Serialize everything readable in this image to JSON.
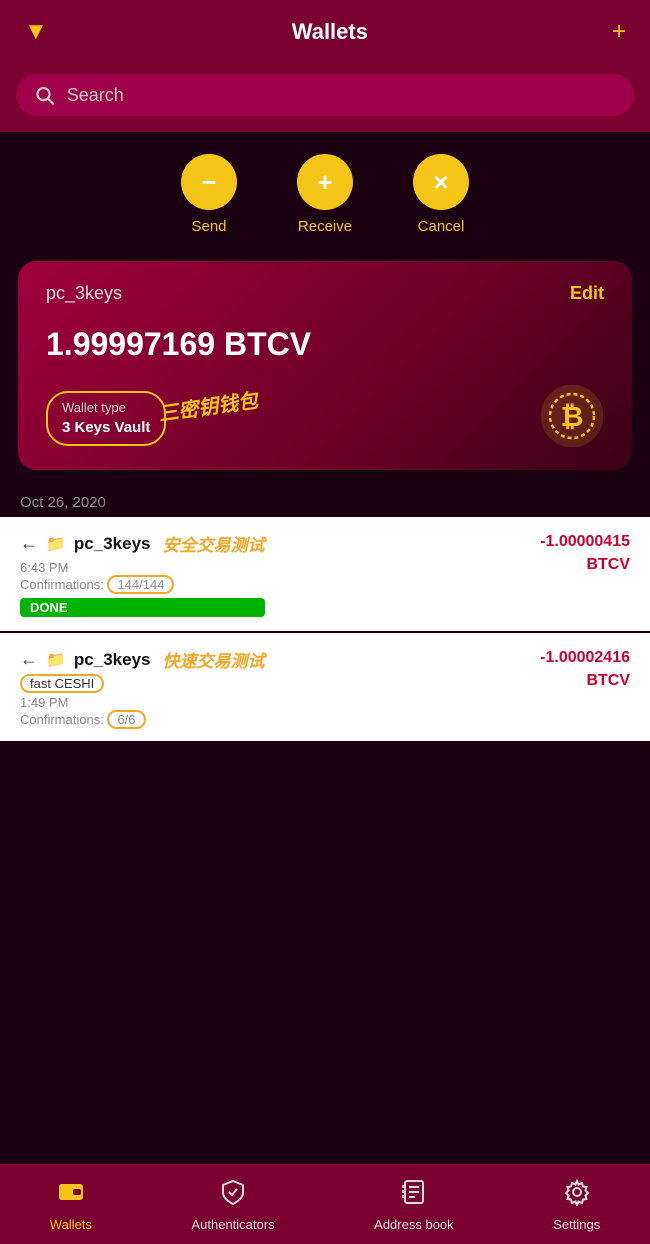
{
  "header": {
    "title": "Wallets",
    "filter_icon": "▼",
    "add_icon": "+"
  },
  "search": {
    "placeholder": "Search"
  },
  "actions": [
    {
      "id": "send",
      "icon": "−",
      "label": "Send"
    },
    {
      "id": "receive",
      "icon": "+",
      "label": "Receive"
    },
    {
      "id": "cancel",
      "icon": "×",
      "label": "Cancel"
    }
  ],
  "wallet_card": {
    "name": "pc_3keys",
    "edit_label": "Edit",
    "amount": "1.99997169 BTCV",
    "wallet_type_label": "Wallet type",
    "wallet_type_value": "3 Keys Vault",
    "annotation": "三密钥钱包"
  },
  "date_separator": "Oct 26, 2020",
  "transactions": [
    {
      "id": "tx1",
      "direction": "←",
      "wallet_name": "pc_3keys",
      "annotation": "安全交易测试",
      "time": "6:43 PM",
      "confirmations_label": "Confirmations:",
      "confirmations_value": "144/144",
      "status": "DONE",
      "amount": "-1.00000415",
      "currency": "BTCV"
    },
    {
      "id": "tx2",
      "direction": "←",
      "wallet_name": "pc_3keys",
      "annotation": "快速交易测试",
      "sub_label": "fast CESHI",
      "time": "1:49 PM",
      "confirmations_label": "Confirmations:",
      "confirmations_value": "6/6",
      "amount": "-1.00002416",
      "currency": "BTCV"
    }
  ],
  "bottom_nav": [
    {
      "id": "wallets",
      "icon": "wallet",
      "label": "Wallets",
      "active": true
    },
    {
      "id": "authenticators",
      "icon": "shield",
      "label": "Authenticators",
      "active": false
    },
    {
      "id": "address-book",
      "icon": "addressbook",
      "label": "Address book",
      "active": false
    },
    {
      "id": "settings",
      "icon": "gear",
      "label": "Settings",
      "active": false
    }
  ]
}
